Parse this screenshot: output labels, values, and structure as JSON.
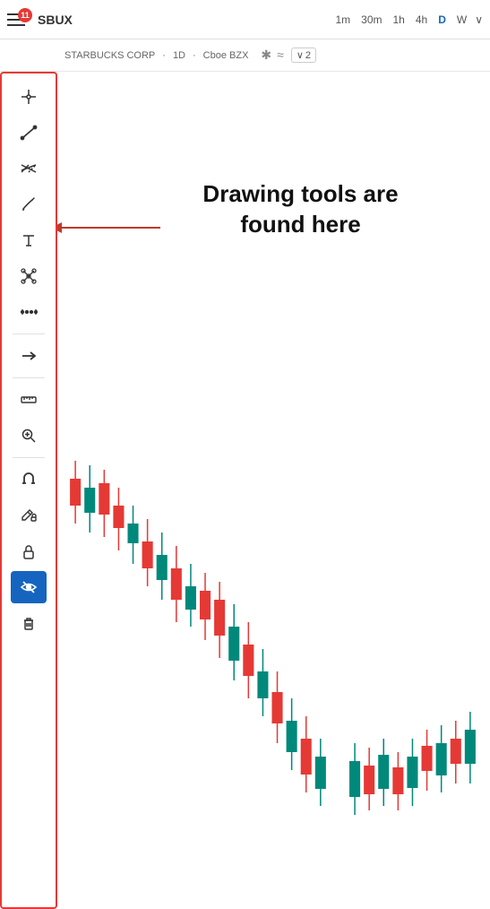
{
  "topbar": {
    "notification_count": "11",
    "ticker": "SBUX",
    "timeframes": [
      "1m",
      "30m",
      "1h",
      "4h",
      "D",
      "W"
    ],
    "active_timeframe": "D",
    "dropdown_arrow": "∨"
  },
  "subtitle": {
    "company": "STARBUCKS CORP",
    "interval": "1D",
    "exchange": "Cboe BZX",
    "star_icon": "✱",
    "approx_icon": "≈",
    "dropdown_label": "2"
  },
  "annotation": {
    "text": "Drawing tools are\nfound here",
    "arrow_direction": "left"
  },
  "toolbar": {
    "tools": [
      {
        "name": "crosshair",
        "icon": "crosshair"
      },
      {
        "name": "line",
        "icon": "line"
      },
      {
        "name": "trend-channel",
        "icon": "trend-channel"
      },
      {
        "name": "brush",
        "icon": "brush"
      },
      {
        "name": "text",
        "icon": "text"
      },
      {
        "name": "node-graph",
        "icon": "node-graph"
      },
      {
        "name": "measure-tool",
        "icon": "measure-dots"
      },
      {
        "name": "arrow",
        "icon": "arrow"
      },
      {
        "name": "ruler",
        "icon": "ruler"
      },
      {
        "name": "zoom",
        "icon": "zoom"
      },
      {
        "name": "magnet",
        "icon": "magnet"
      },
      {
        "name": "lock-edit",
        "icon": "lock-edit"
      },
      {
        "name": "lock",
        "icon": "lock"
      },
      {
        "name": "hide-drawings",
        "icon": "hide-drawings"
      },
      {
        "name": "trash",
        "icon": "trash"
      }
    ]
  }
}
